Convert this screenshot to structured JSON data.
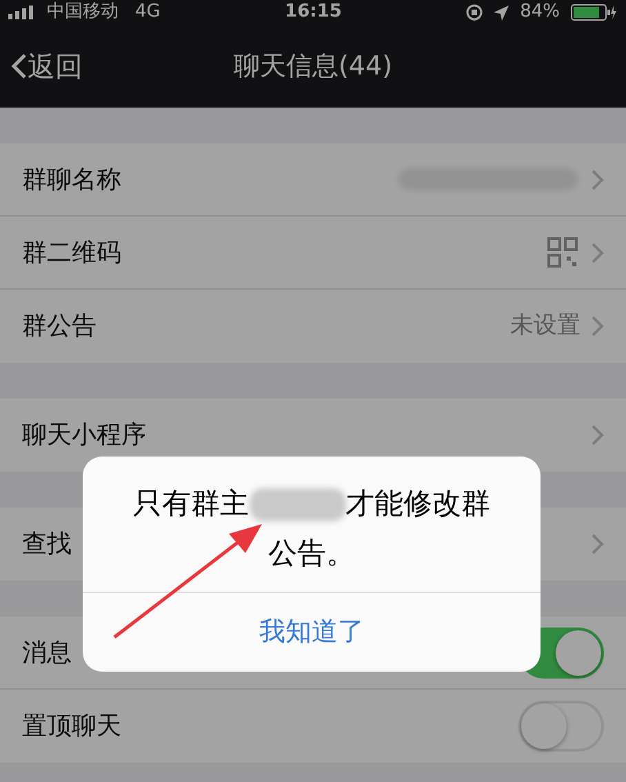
{
  "status_bar": {
    "carrier": "中国移动",
    "network": "4G",
    "time": "16:15",
    "battery": "84%"
  },
  "nav": {
    "back": "返回",
    "title": "聊天信息(44)"
  },
  "groups": [
    {
      "rows": [
        {
          "kind": "blurred",
          "label": "群聊名称"
        },
        {
          "kind": "qr",
          "label": "群二维码"
        },
        {
          "kind": "value",
          "label": "群公告",
          "value": "未设置"
        }
      ]
    },
    {
      "rows": [
        {
          "kind": "plain",
          "label": "聊天小程序"
        }
      ]
    },
    {
      "rows": [
        {
          "kind": "plain",
          "label": "查找"
        }
      ]
    },
    {
      "rows": [
        {
          "kind": "toggle",
          "label": "消息",
          "on": true
        },
        {
          "kind": "toggle",
          "label": "置顶聊天",
          "on": false
        }
      ]
    }
  ],
  "dialog": {
    "message_before": "只有群主",
    "message_after": "才能修改群公告。",
    "button": "我知道了"
  }
}
